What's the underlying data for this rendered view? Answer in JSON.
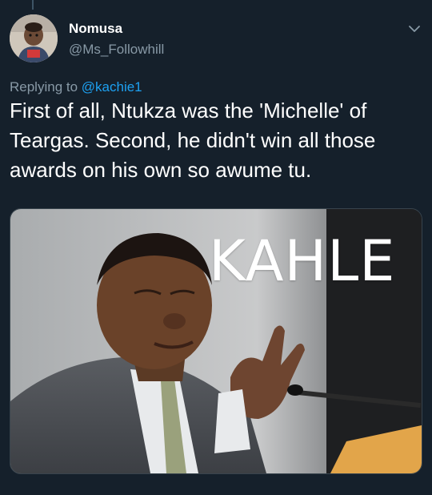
{
  "tweet": {
    "author_name": "Nomusa",
    "author_handle": "@Ms_Followhill",
    "reply_prefix": "Replying to ",
    "reply_to": "@kachie1",
    "text": "First of all, Ntukza was the 'Michelle' of Teargas. Second, he didn't win all those awards on his own so awume tu.",
    "media_caption": "KAHLE"
  },
  "icons": {
    "menu": "chevron-down-icon",
    "avatar": "avatar"
  },
  "colors": {
    "background": "#15202b",
    "secondary_text": "#8899a6",
    "link": "#1da1f2",
    "primary_text": "#ffffff"
  }
}
